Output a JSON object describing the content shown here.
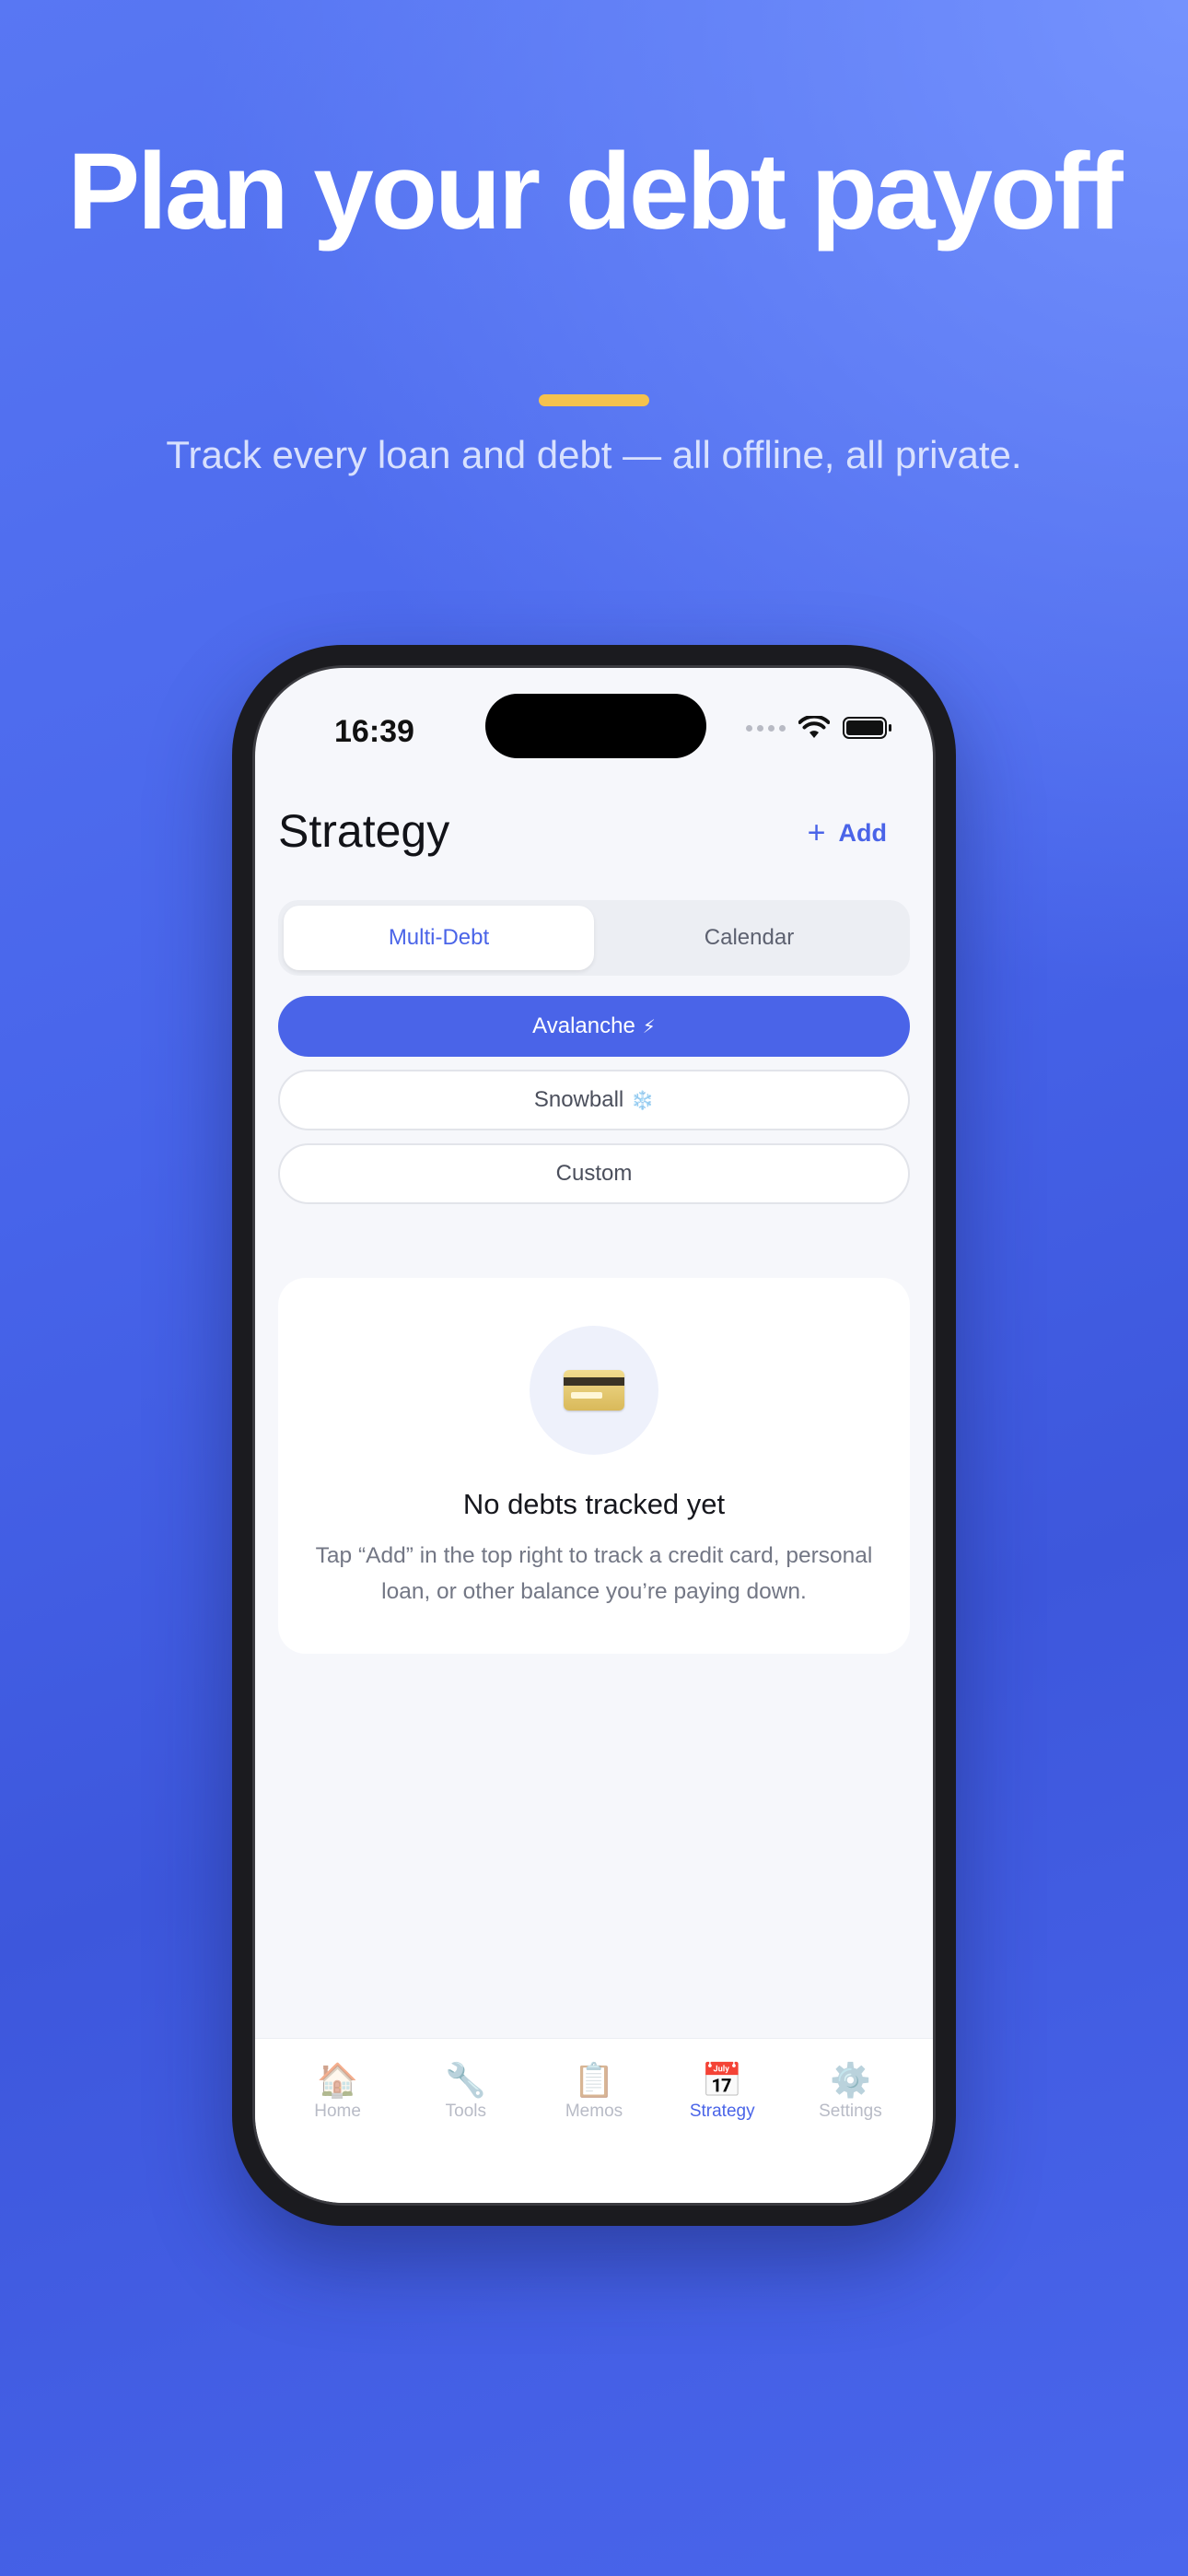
{
  "promo": {
    "headline": "Plan your debt payoff",
    "subtitle": "Track every loan and debt — all offline, all private.",
    "accent_color": "#f4c24e"
  },
  "status_bar": {
    "time": "16:39"
  },
  "header": {
    "title": "Strategy",
    "add_label": "Add",
    "add_icon": "plus-icon"
  },
  "segmented": {
    "items": [
      {
        "label": "Multi-Debt",
        "selected": true
      },
      {
        "label": "Calendar",
        "selected": false
      }
    ]
  },
  "strategies": [
    {
      "label": "Avalanche",
      "emoji": "⚡",
      "selected": true
    },
    {
      "label": "Snowball",
      "emoji": "❄️",
      "selected": false
    },
    {
      "label": "Custom",
      "emoji": "",
      "selected": false
    }
  ],
  "empty_state": {
    "icon": "credit-card-icon",
    "title": "No debts tracked yet",
    "description": "Tap “Add” in the top right to track a credit card, personal loan, or other balance you’re paying down."
  },
  "tabbar": {
    "items": [
      {
        "label": "Home",
        "icon": "🏠",
        "active": false
      },
      {
        "label": "Tools",
        "icon": "🔧",
        "active": false
      },
      {
        "label": "Memos",
        "icon": "📋",
        "active": false
      },
      {
        "label": "Strategy",
        "icon": "📅",
        "active": true
      },
      {
        "label": "Settings",
        "icon": "⚙️",
        "active": false
      }
    ]
  },
  "colors": {
    "primary": "#4a64e8",
    "background_top": "#5877f3",
    "background_bottom": "#3d57dc"
  }
}
